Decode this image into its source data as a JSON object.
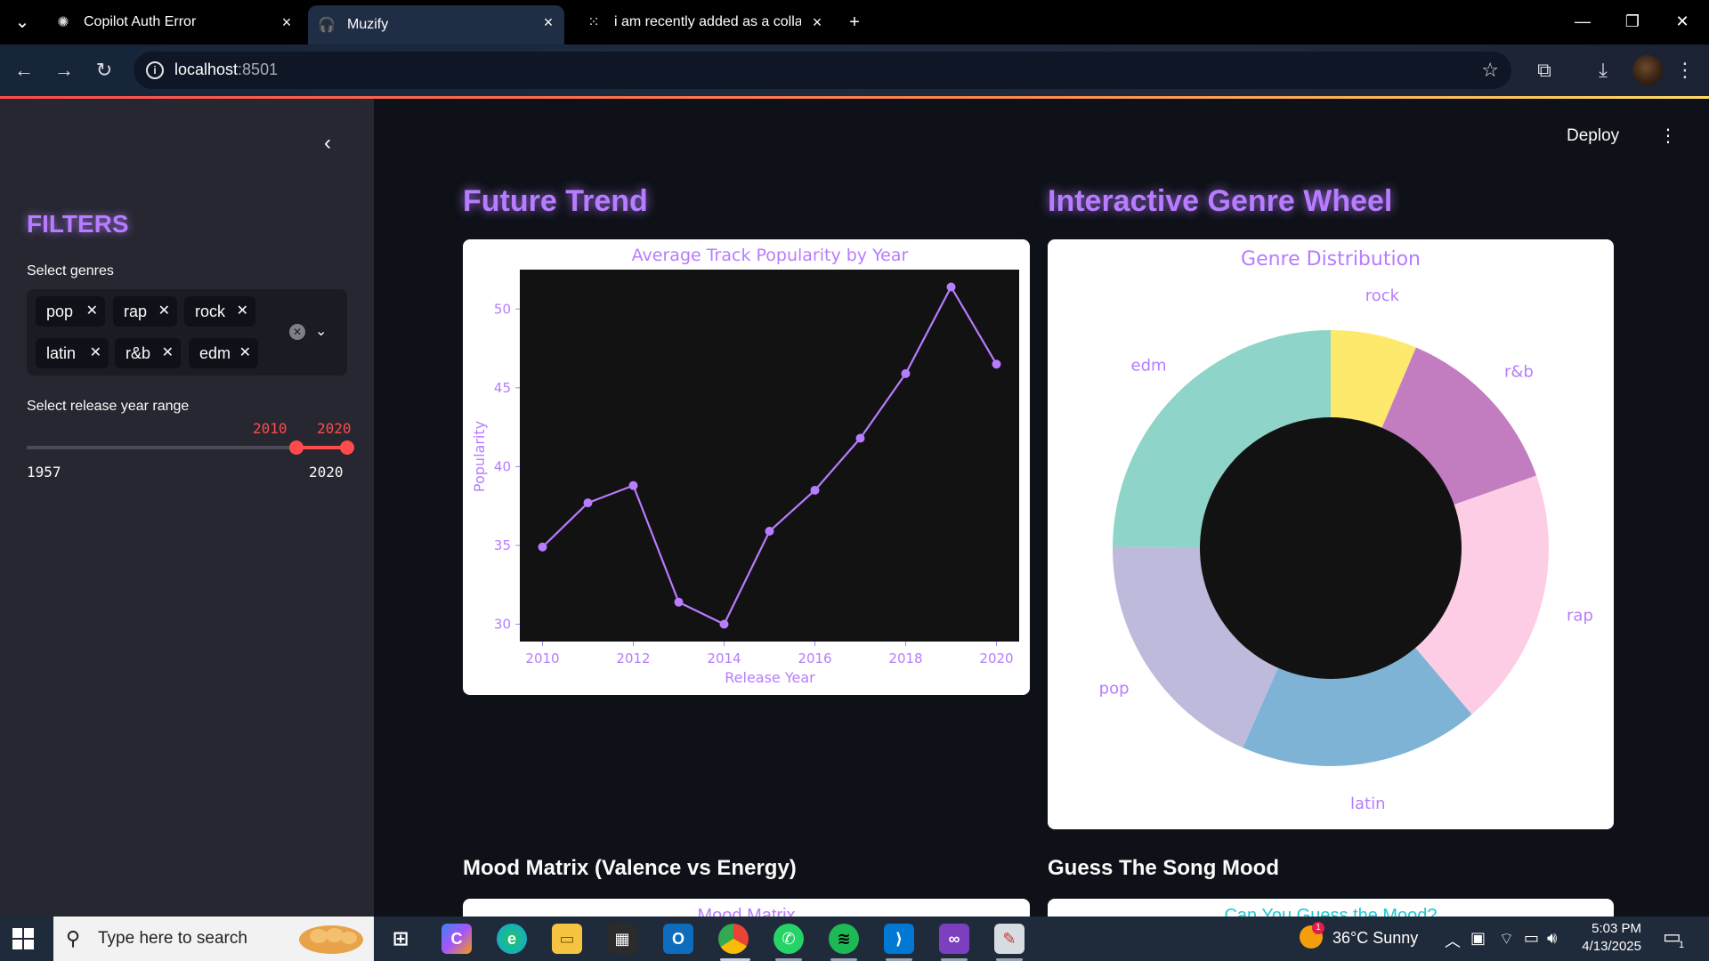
{
  "browser": {
    "tabs": [
      {
        "title": "Copilot Auth Error",
        "icon": "openai-icon"
      },
      {
        "title": "Muzify",
        "icon": "headphones-icon"
      },
      {
        "title": "i am recently added as a collabo",
        "icon": "loading-icon"
      }
    ],
    "url_host": "localhost",
    "url_port": ":8501"
  },
  "app": {
    "deploy_label": "Deploy",
    "sidebar": {
      "title": "FILTERS",
      "genres_label": "Select genres",
      "genres": [
        "pop",
        "rap",
        "rock",
        "latin",
        "r&b",
        "edm"
      ],
      "year_label": "Select release year range",
      "year_selected": [
        "2010",
        "2020"
      ],
      "year_min": "1957",
      "year_max": "2020",
      "range_min": 1957,
      "range_max": 2020,
      "range_low": 2010,
      "range_high": 2020
    },
    "sections": {
      "future_trend": "Future Trend",
      "genre_wheel": "Interactive Genre Wheel",
      "mood_matrix": "Mood Matrix (Valence vs Energy)",
      "guess_mood": "Guess The Song Mood"
    },
    "peek": {
      "mood_matrix_chart_title": "Mood Matrix",
      "guess_chart_title": "Can You Guess the Mood?"
    }
  },
  "chart_data": [
    {
      "type": "line",
      "title": "Average Track Popularity by Year",
      "xlabel": "Release Year",
      "ylabel": "Popularity",
      "x": [
        2010,
        2011,
        2012,
        2013,
        2014,
        2015,
        2016,
        2017,
        2018,
        2019,
        2020
      ],
      "y": [
        34.9,
        37.7,
        38.8,
        31.4,
        30.0,
        35.9,
        38.5,
        41.8,
        45.9,
        51.4,
        46.5
      ],
      "xticks": [
        "2010",
        "2012",
        "2014",
        "2016",
        "2018",
        "2020"
      ],
      "yticks": [
        "30",
        "35",
        "40",
        "45",
        "50"
      ],
      "xlim": [
        2009.5,
        2020.5
      ],
      "ylim": [
        28.9,
        52.5
      ],
      "color": "#b77cff",
      "background": "#121212"
    },
    {
      "type": "pie",
      "title": "Genre Distribution",
      "donut": true,
      "labels": [
        "rock",
        "r&b",
        "rap",
        "latin",
        "pop",
        "edm"
      ],
      "values": [
        6.4,
        13.2,
        19.2,
        17.8,
        18.5,
        24.9
      ],
      "colors": [
        "#fde96b",
        "#c17dc0",
        "#fdcde6",
        "#7fb3d5",
        "#bebadb",
        "#8fd4c8"
      ],
      "hole_color": "#121212"
    }
  ],
  "taskbar": {
    "search_placeholder": "Type here to search",
    "weather": "36°C  Sunny",
    "time": "5:03 PM",
    "date": "4/13/2025",
    "notification_count": "1",
    "weather_badge": "1"
  }
}
